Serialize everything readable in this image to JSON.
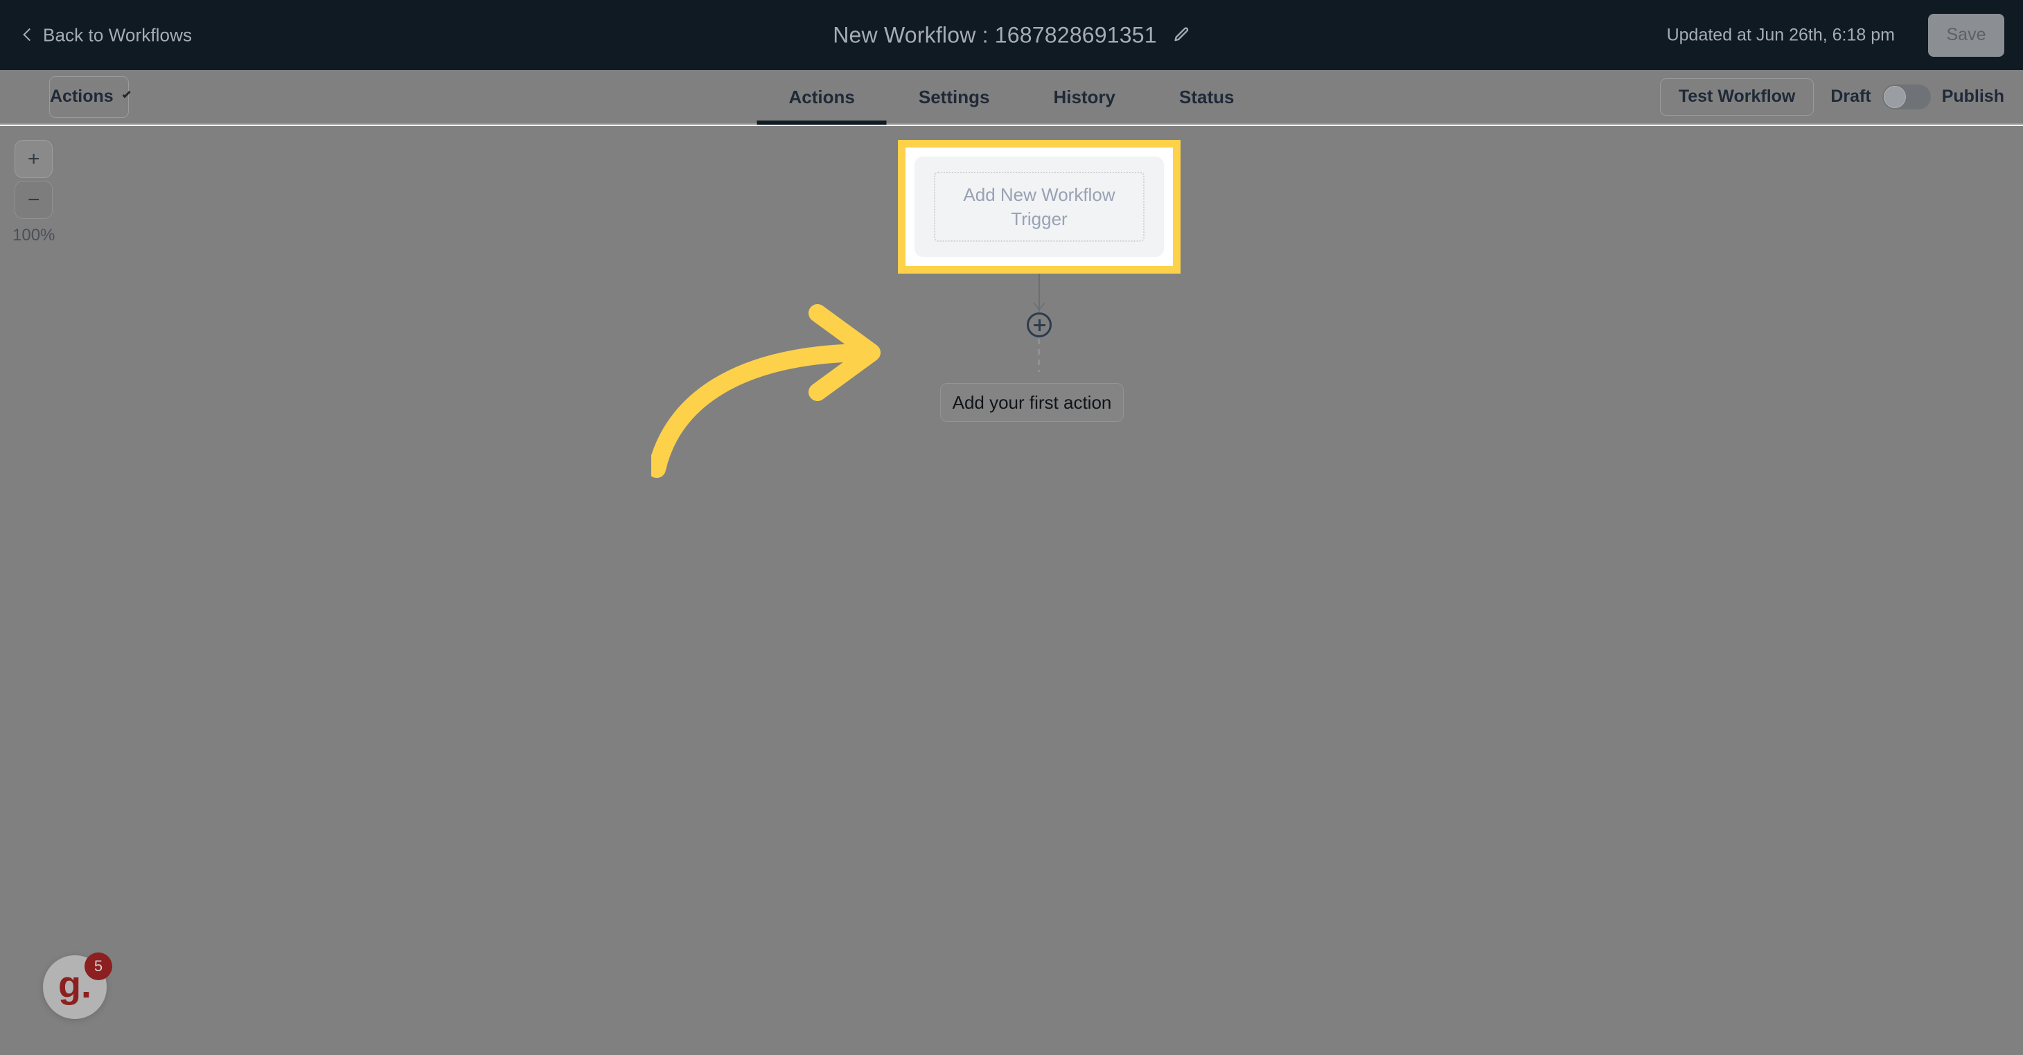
{
  "header": {
    "back_label": "Back to Workflows",
    "back_icon": "chevron-left-icon",
    "title": "New Workflow : 1687828691351",
    "edit_icon": "pencil-icon",
    "updated_at": "Updated at Jun 26th, 6:18 pm",
    "save_label": "Save",
    "background_color": "#101a22",
    "text_color": "#a6acb3"
  },
  "toolbar": {
    "actions_dropdown_label": "Actions",
    "chevron_icon": "chevron-down-icon",
    "tabs": [
      {
        "label": "Actions",
        "active": true
      },
      {
        "label": "Settings",
        "active": false
      },
      {
        "label": "History",
        "active": false
      },
      {
        "label": "Status",
        "active": false
      }
    ],
    "test_workflow_label": "Test Workflow",
    "draft_label": "Draft",
    "publish_label": "Publish",
    "toggle_state": "off"
  },
  "canvas": {
    "zoom": {
      "plus_icon": "plus-icon",
      "plus_label": "+",
      "minus_icon": "minus-icon",
      "minus_label": "−",
      "level": "100%"
    },
    "trigger": {
      "label": "Add New Workflow Trigger",
      "highlight_color": "#fdd14a",
      "card_color": "#f1f3f5",
      "text_color": "#98a2b3"
    },
    "add_node": {
      "icon": "plus-circle-icon"
    },
    "first_action": {
      "label": "Add your first action"
    },
    "annotation": {
      "arrow_icon": "curved-arrow-right-icon",
      "arrow_color": "#fdd14a"
    },
    "overlay_color": "#808080"
  },
  "help_launcher": {
    "logo_text": "g.",
    "badge_count": "5",
    "badge_color": "#8c1f1f"
  }
}
